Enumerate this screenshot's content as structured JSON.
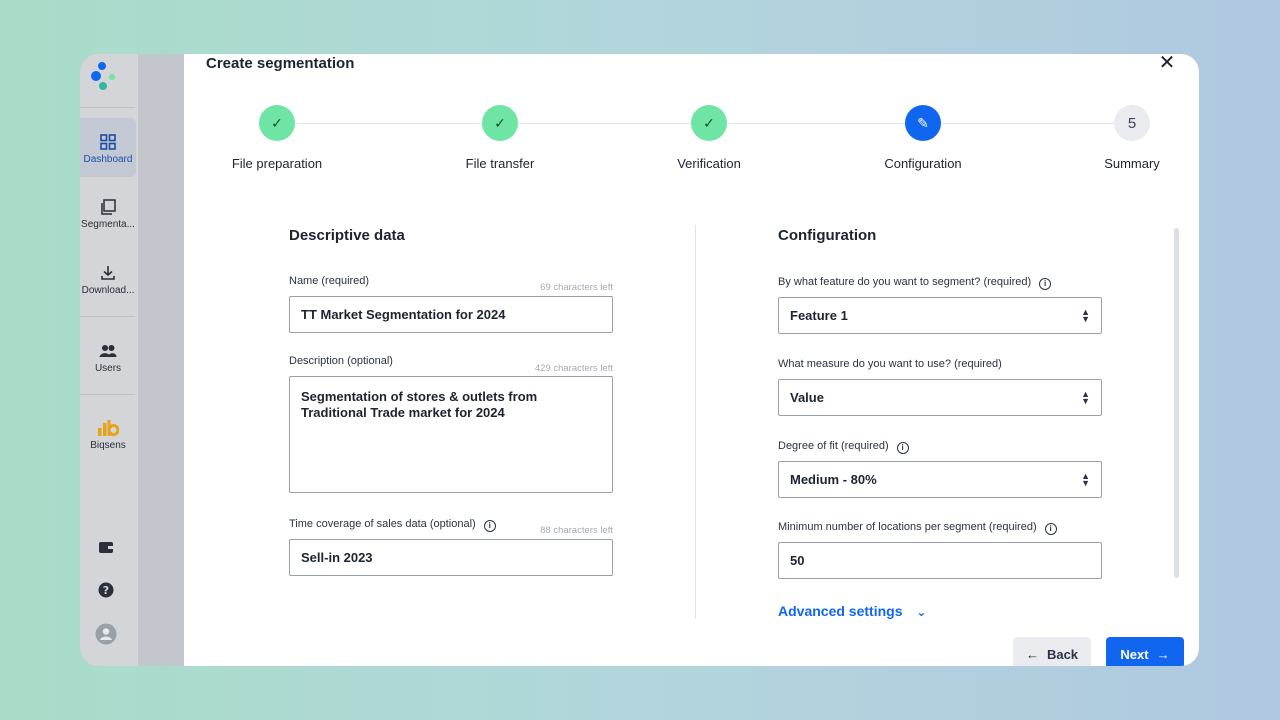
{
  "sidebar": {
    "items": [
      {
        "label": "Dashboard",
        "icon": "grid-icon"
      },
      {
        "label": "Segmenta...",
        "icon": "copy-icon"
      },
      {
        "label": "Download...",
        "icon": "download-icon"
      },
      {
        "label": "Users",
        "icon": "users-icon"
      },
      {
        "label": "Biqsens",
        "icon": "biqsens-logo-icon"
      }
    ],
    "bottom_icons": [
      "wallet-icon",
      "help-icon",
      "profile-icon"
    ]
  },
  "modal": {
    "title": "Create segmentation",
    "close_glyph": "✕"
  },
  "stepper": {
    "steps": [
      {
        "label": "File preparation",
        "state": "done",
        "glyph": "✓"
      },
      {
        "label": "File transfer",
        "state": "done",
        "glyph": "✓"
      },
      {
        "label": "Verification",
        "state": "done",
        "glyph": "✓"
      },
      {
        "label": "Configuration",
        "state": "current",
        "glyph": "✎"
      },
      {
        "label": "Summary",
        "state": "todo",
        "glyph": "5"
      }
    ]
  },
  "descriptive": {
    "title": "Descriptive data",
    "name": {
      "label": "Name (required)",
      "hint": "69 characters left",
      "value": "TT Market Segmentation for 2024"
    },
    "description": {
      "label": "Description (optional)",
      "hint": "429 characters left",
      "value": "Segmentation of stores & outlets from Traditional Trade market for 2024"
    },
    "time_coverage": {
      "label": "Time coverage of sales data (optional)",
      "hint": "88 characters left",
      "value": "Sell-in 2023"
    }
  },
  "configuration": {
    "title": "Configuration",
    "feature": {
      "label": "By what feature do you want to segment? (required)",
      "value": "Feature 1"
    },
    "measure": {
      "label": "What measure do you want to use? (required)",
      "value": "Value"
    },
    "fit": {
      "label": "Degree of fit (required)",
      "value": "Medium - 80%"
    },
    "min_locations": {
      "label": "Minimum number of locations per segment (required)",
      "value": "50"
    },
    "advanced_label": "Advanced settings"
  },
  "footer": {
    "back_label": "Back",
    "next_label": "Next"
  },
  "colors": {
    "primary": "#1166f0",
    "done": "#6ee5a4"
  }
}
